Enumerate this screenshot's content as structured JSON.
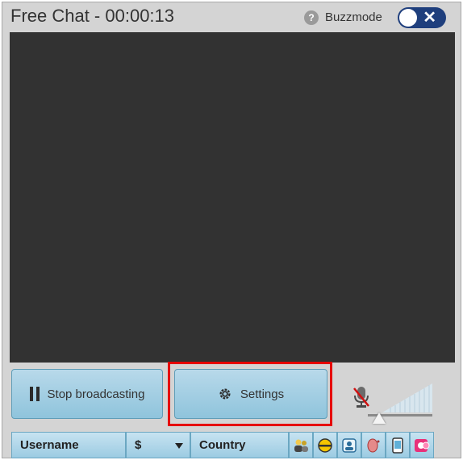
{
  "window": {
    "title": "Free Chat - 00:00:13",
    "help_icon_glyph": "?",
    "buzzmode_label": "Buzzmode",
    "toggle_close_glyph": "✕"
  },
  "controls": {
    "stop_label": "Stop broadcasting",
    "settings_label": "Settings"
  },
  "table_header": {
    "username": "Username",
    "dollar": "$",
    "country": "Country",
    "icons": [
      "users-icon",
      "half-circle-icon",
      "portrait-icon",
      "ear-icon",
      "tablet-icon",
      "coins-icon"
    ]
  },
  "colors": {
    "highlight": "#e60000",
    "toggle": "#1f3f7d",
    "video_bg": "#323232",
    "button": "#8fc4dc"
  }
}
